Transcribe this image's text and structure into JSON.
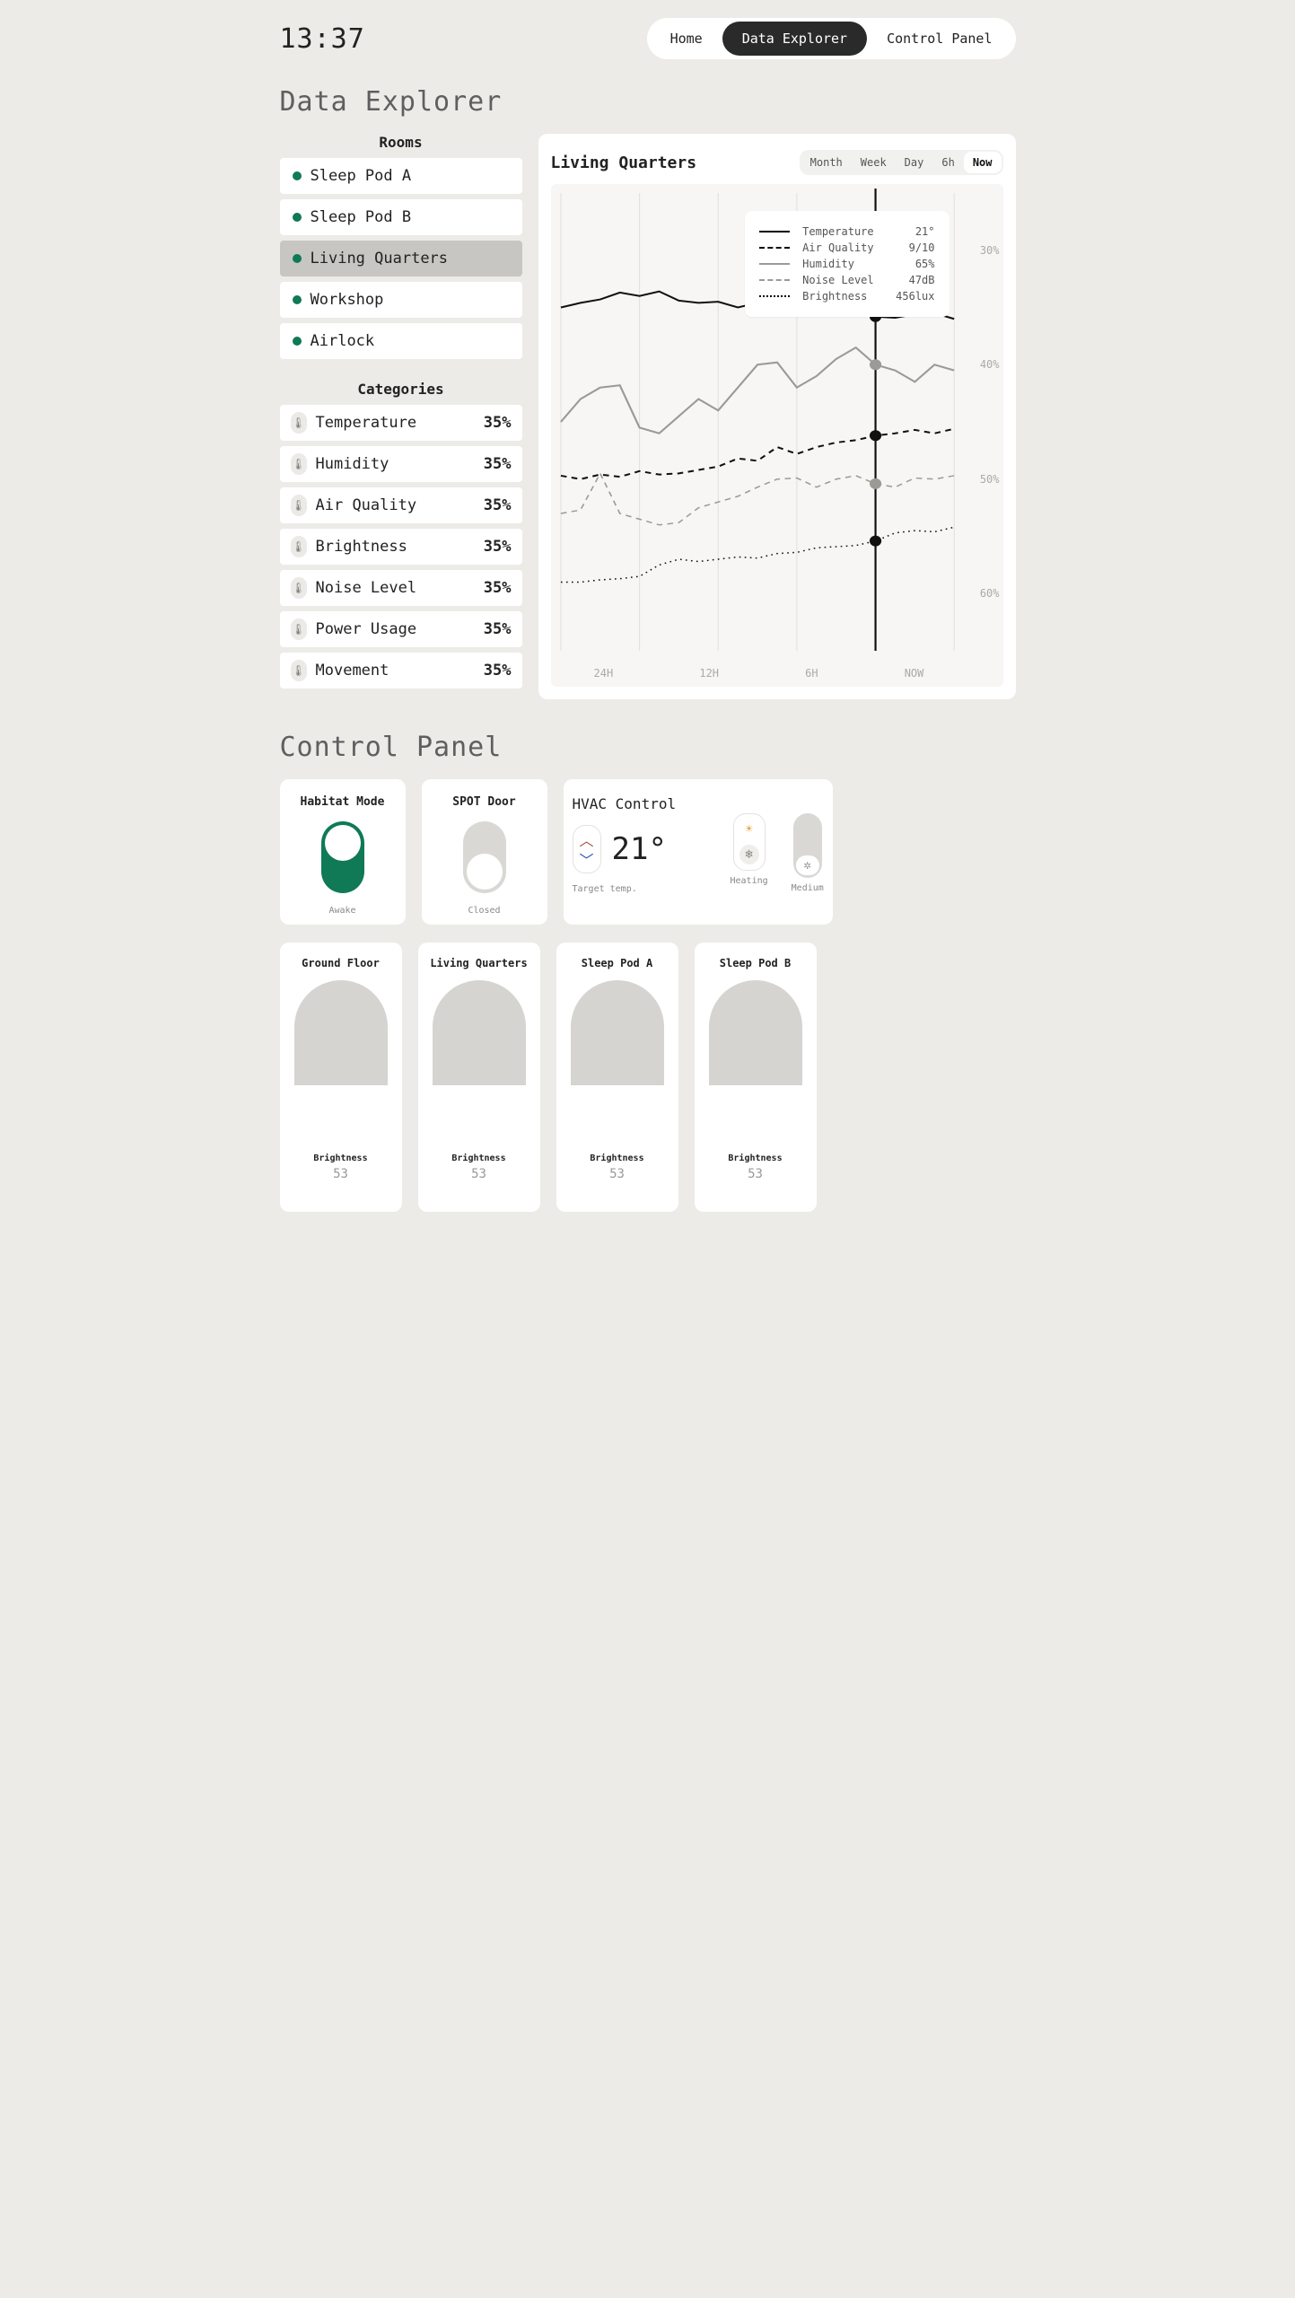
{
  "header": {
    "time": "13:37"
  },
  "nav": {
    "items": [
      "Home",
      "Data Explorer",
      "Control Panel"
    ],
    "active": "Data Explorer"
  },
  "sections": {
    "explorer_title": "Data Explorer",
    "control_title": "Control Panel"
  },
  "rooms": {
    "heading": "Rooms",
    "items": [
      {
        "name": "Sleep Pod A",
        "active": false
      },
      {
        "name": "Sleep Pod B",
        "active": false
      },
      {
        "name": "Living Quarters",
        "active": true
      },
      {
        "name": "Workshop",
        "active": false
      },
      {
        "name": "Airlock",
        "active": false
      }
    ]
  },
  "categories": {
    "heading": "Categories",
    "items": [
      {
        "name": "Temperature",
        "value": "35%"
      },
      {
        "name": "Humidity",
        "value": "35%"
      },
      {
        "name": "Air Quality",
        "value": "35%"
      },
      {
        "name": "Brightness",
        "value": "35%"
      },
      {
        "name": "Noise Level",
        "value": "35%"
      },
      {
        "name": "Power Usage",
        "value": "35%"
      },
      {
        "name": "Movement",
        "value": "35%"
      }
    ]
  },
  "chart": {
    "room_title": "Living Quarters",
    "ranges": [
      "Month",
      "Week",
      "Day",
      "6h",
      "Now"
    ],
    "active_range": "Now",
    "x_labels": [
      "24H",
      "12H",
      "6H",
      "NOW"
    ],
    "legend": [
      {
        "label": "Temperature",
        "value": "21°"
      },
      {
        "label": "Air Quality",
        "value": "9/10"
      },
      {
        "label": "Humidity",
        "value": "65%"
      },
      {
        "label": "Noise Level",
        "value": "47dB"
      },
      {
        "label": "Brightness",
        "value": "456lux"
      }
    ],
    "y_ticks": [
      "60%",
      "50%",
      "40%",
      "30%"
    ]
  },
  "chart_data": {
    "type": "line",
    "x_labels": [
      "24H",
      "12H",
      "6H",
      "NOW"
    ],
    "ylim": [
      25,
      65
    ],
    "y_ticks": [
      30,
      40,
      50,
      60
    ],
    "series": [
      {
        "name": "Temperature",
        "style": "solid-black",
        "values": [
          55,
          55.4,
          55.7,
          56.3,
          56,
          56.4,
          55.6,
          55.4,
          55.5,
          55,
          55.4,
          55.1,
          54.6,
          54.7,
          54.5,
          54.5,
          54.2,
          54.1,
          54.4,
          54.5,
          54
        ],
        "legend_value": "21°"
      },
      {
        "name": "Air Quality",
        "style": "dashed-black",
        "values": [
          40.3,
          40,
          40.4,
          40.2,
          40.7,
          40.4,
          40.5,
          40.8,
          41.1,
          41.8,
          41.6,
          42.8,
          42.2,
          42.8,
          43.2,
          43.4,
          43.8,
          44,
          44.3,
          44,
          44.4
        ],
        "legend_value": "9/10"
      },
      {
        "name": "Humidity",
        "style": "solid-grey",
        "values": [
          45,
          47,
          48,
          48.2,
          44.5,
          44,
          45.5,
          47,
          46,
          48,
          50,
          50.2,
          48,
          49,
          50.5,
          51.5,
          50,
          49.5,
          48.5,
          50,
          49.5
        ],
        "legend_value": "65%"
      },
      {
        "name": "Noise Level",
        "style": "dashed-grey",
        "values": [
          37,
          37.3,
          40.5,
          37,
          36.5,
          36,
          36.2,
          37.5,
          38,
          38.5,
          39.3,
          40,
          40.1,
          39.3,
          40,
          40.3,
          39.6,
          39.3,
          40.1,
          40,
          40.3
        ],
        "legend_value": "47dB"
      },
      {
        "name": "Brightness",
        "style": "dotted-black",
        "values": [
          31,
          31,
          31.2,
          31.3,
          31.5,
          32.5,
          33,
          32.8,
          33,
          33.2,
          33.1,
          33.5,
          33.6,
          34,
          34.1,
          34.2,
          34.6,
          35.3,
          35.5,
          35.4,
          35.8
        ],
        "legend_value": "456lux"
      }
    ]
  },
  "control": {
    "habitat": {
      "title": "Habitat Mode",
      "state": "Awake",
      "on": true
    },
    "spot": {
      "title": "SPOT Door",
      "state": "Closed",
      "on": false
    },
    "hvac": {
      "title": "HVAC Control",
      "target_label": "Target temp.",
      "target_value": "21°",
      "mode_label": "Heating",
      "fan_label": "Medium"
    },
    "lights": {
      "label": "Brightness",
      "rooms": [
        {
          "name": "Ground Floor",
          "value": "53"
        },
        {
          "name": "Living Quarters",
          "value": "53"
        },
        {
          "name": "Sleep Pod A",
          "value": "53"
        },
        {
          "name": "Sleep Pod B",
          "value": "53"
        }
      ]
    }
  }
}
